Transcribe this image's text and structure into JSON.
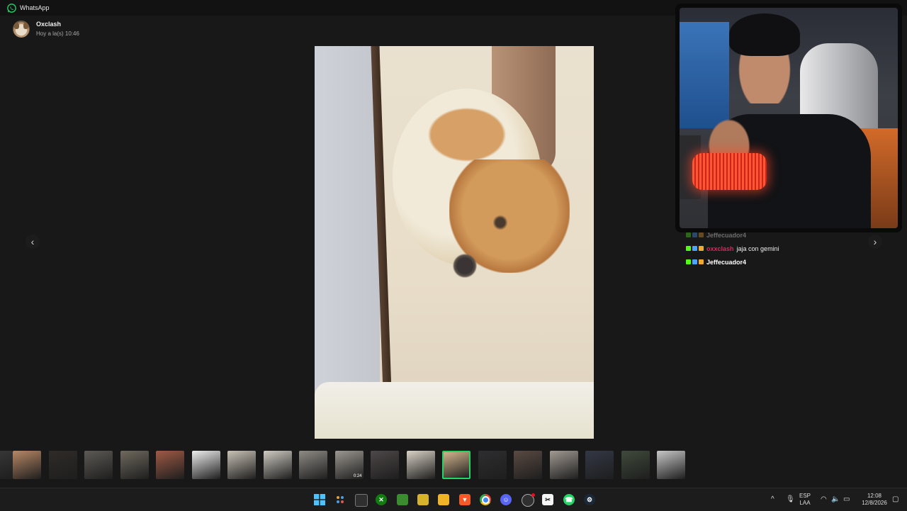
{
  "window": {
    "app_title": "WhatsApp"
  },
  "sender": {
    "name": "Oxclash",
    "time": "Hoy a la(s) 10:46"
  },
  "navigation": {
    "prev_symbol": "‹",
    "next_symbol": "›"
  },
  "chat_overlay": {
    "lines": [
      {
        "user": "Jeffecuador4",
        "message": "",
        "user_color": "#ffffff",
        "ghost": true
      },
      {
        "user": "oxxclash",
        "message": "jaja con gemini",
        "user_color": "#e0245e",
        "ghost": false
      },
      {
        "user": "Jeffecuador4",
        "message": "",
        "user_color": "#ffffff",
        "ghost": false
      }
    ]
  },
  "thumbnails": [
    {
      "name": "thumb-partial",
      "color": "#3a3a3a"
    },
    {
      "name": "thumb-boy",
      "color": "#b88865"
    },
    {
      "name": "thumb-pou",
      "color": "#2f2b28"
    },
    {
      "name": "thumb-room-dark",
      "color": "#5d5a55"
    },
    {
      "name": "thumb-hands",
      "color": "#6f6a5e"
    },
    {
      "name": "thumb-food",
      "color": "#a05a45"
    },
    {
      "name": "thumb-document",
      "color": "#eeeeee"
    },
    {
      "name": "thumb-room-light",
      "color": "#c9c2b6"
    },
    {
      "name": "thumb-floor",
      "color": "#cfcbc3"
    },
    {
      "name": "thumb-blur",
      "color": "#8f8b85"
    },
    {
      "name": "thumb-video",
      "color": "#9c9790",
      "duration": "0:24"
    },
    {
      "name": "thumb-selfie",
      "color": "#4d4748"
    },
    {
      "name": "thumb-text-card",
      "color": "#d9d2c6"
    },
    {
      "name": "thumb-dog-selected",
      "color": "#d2b48c"
    },
    {
      "name": "thumb-screen",
      "color": "#2e2e30"
    },
    {
      "name": "thumb-hands-2",
      "color": "#5a4a42"
    },
    {
      "name": "thumb-cloth",
      "color": "#a19a92"
    },
    {
      "name": "thumb-desktop",
      "color": "#333845"
    },
    {
      "name": "thumb-green-screen",
      "color": "#3f4a3b"
    },
    {
      "name": "thumb-window",
      "color": "#c8c8c8"
    }
  ],
  "taskbar": {
    "language_line1": "ESP",
    "language_line2": "LAA",
    "clock_time": "12:08",
    "clock_date": "12/8/2026"
  }
}
